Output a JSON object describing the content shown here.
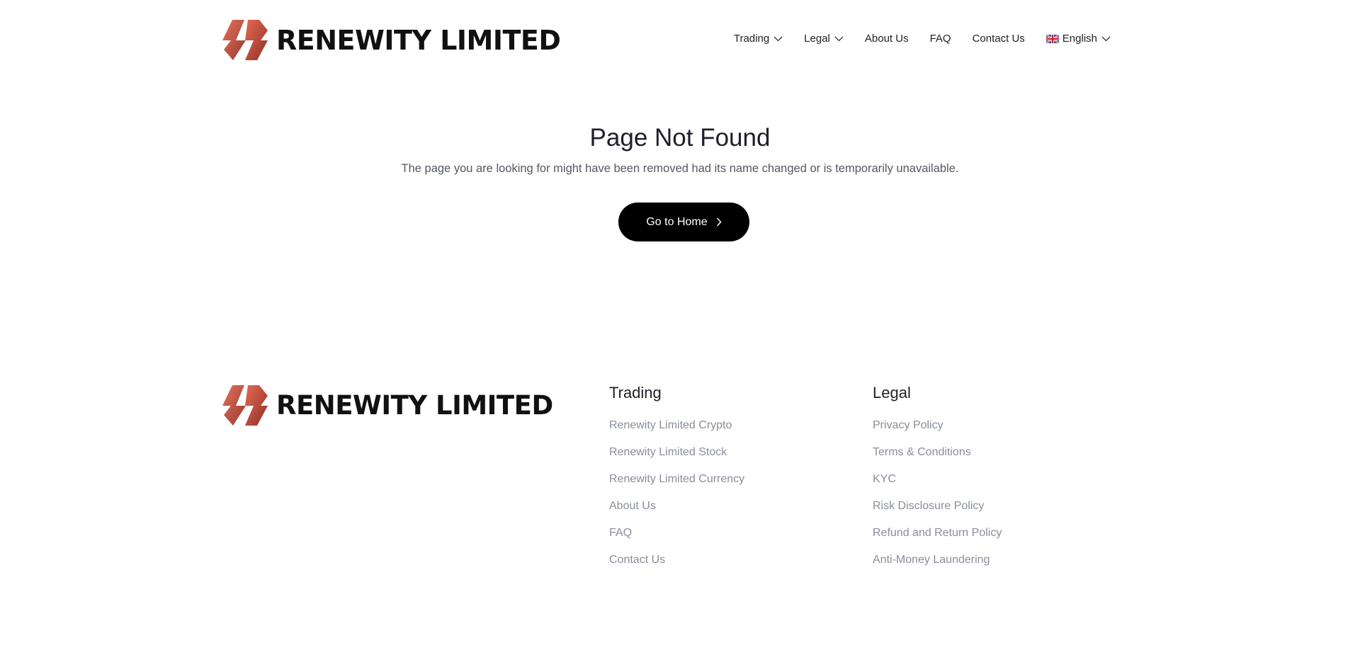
{
  "brand": {
    "name": "RENEWITY LIMITED"
  },
  "nav": {
    "items": [
      {
        "label": "Trading",
        "has_dropdown": true
      },
      {
        "label": "Legal",
        "has_dropdown": true
      },
      {
        "label": "About Us",
        "has_dropdown": false
      },
      {
        "label": "FAQ",
        "has_dropdown": false
      },
      {
        "label": "Contact Us",
        "has_dropdown": false
      }
    ],
    "language": {
      "label": "English",
      "icon": "uk-flag-icon"
    }
  },
  "not_found": {
    "title": "Page Not Found",
    "description": "The page you are looking for might have been removed had its name changed or is temporarily unavailable.",
    "button_label": "Go to Home"
  },
  "footer": {
    "trading": {
      "heading": "Trading",
      "links": [
        "Renewity Limited Crypto",
        "Renewity Limited Stock",
        "Renewity Limited Currency",
        "About Us",
        "FAQ",
        "Contact Us"
      ]
    },
    "legal": {
      "heading": "Legal",
      "links": [
        "Privacy Policy",
        "Terms & Conditions",
        "KYC",
        "Risk Disclosure Policy",
        "Refund and Return Policy",
        "Anti-Money Laundering"
      ]
    }
  },
  "colors": {
    "logo_red_light": "#e0654f",
    "logo_red_dark": "#8a2e26",
    "button_bg": "#000000",
    "footer_link": "#8a8e99"
  }
}
